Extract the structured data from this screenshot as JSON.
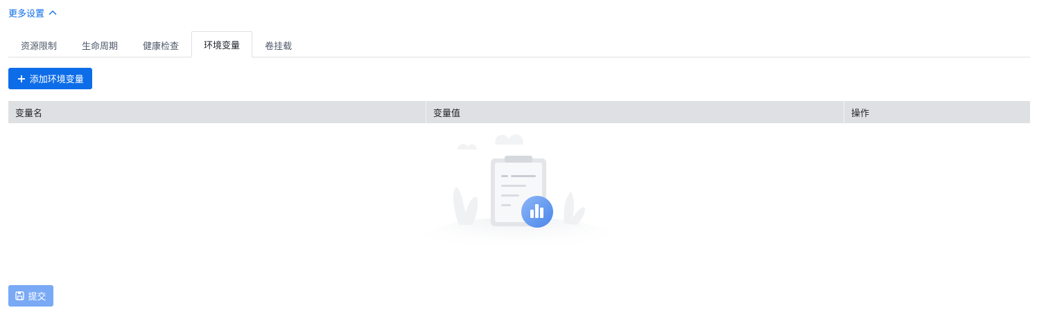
{
  "more_settings": {
    "label": "更多设置",
    "expanded": true,
    "icon": "chevron-up-icon"
  },
  "tabs": [
    {
      "label": "资源限制",
      "active": false
    },
    {
      "label": "生命周期",
      "active": false
    },
    {
      "label": "健康检查",
      "active": false
    },
    {
      "label": "环境变量",
      "active": true
    },
    {
      "label": "卷挂载",
      "active": false
    }
  ],
  "add_button": {
    "label": "添加环境变量",
    "icon": "plus-icon"
  },
  "table": {
    "columns": [
      "变量名",
      "变量值",
      "操作"
    ],
    "rows": []
  },
  "empty_state": {
    "icon": "empty-clipboard-chart-illustration"
  },
  "submit_button": {
    "label": "提交",
    "icon": "save-icon",
    "disabled": true
  },
  "colors": {
    "primary": "#0d6de8",
    "primary_disabled": "#7aa9f5",
    "table_header_bg": "#dee0e3",
    "border": "#dee0e3"
  }
}
